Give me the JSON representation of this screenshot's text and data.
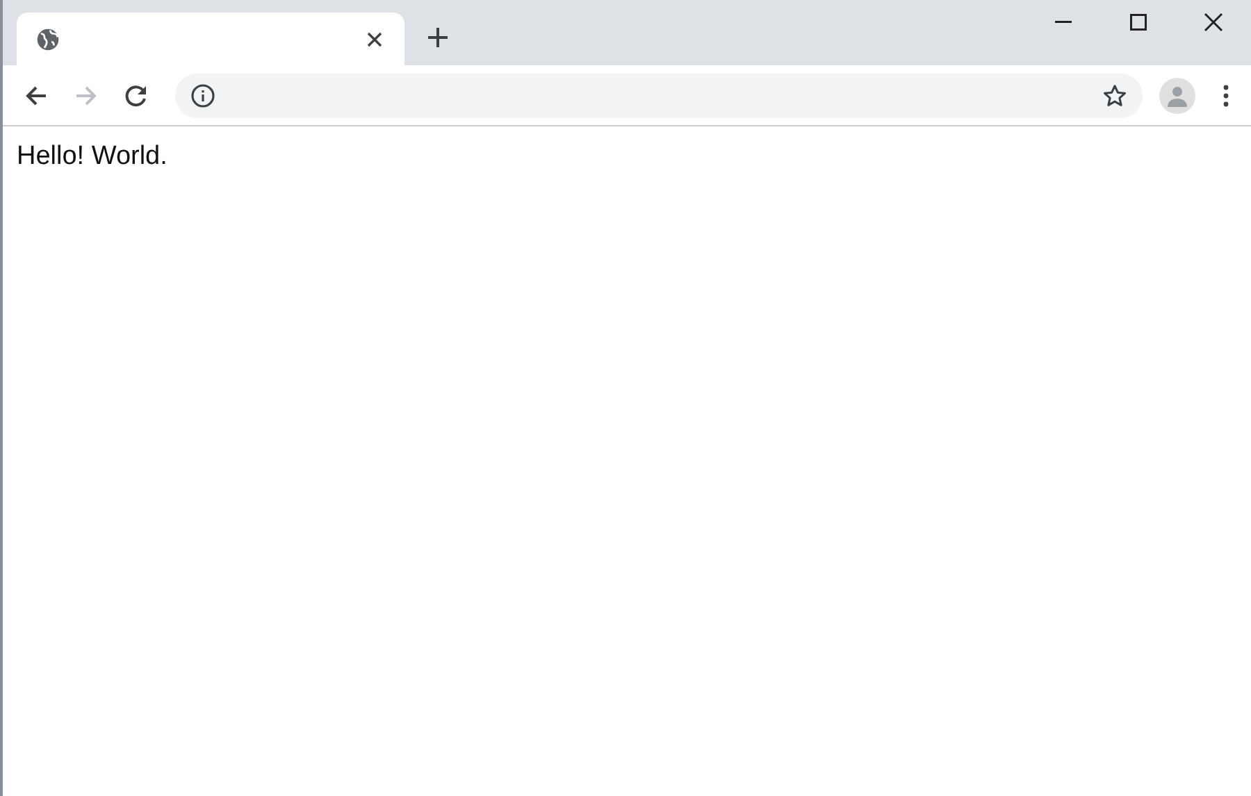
{
  "tabs": [
    {
      "selected": true
    }
  ],
  "navigation": {
    "forward_disabled": true
  },
  "page": {
    "text": "Hello! World."
  }
}
